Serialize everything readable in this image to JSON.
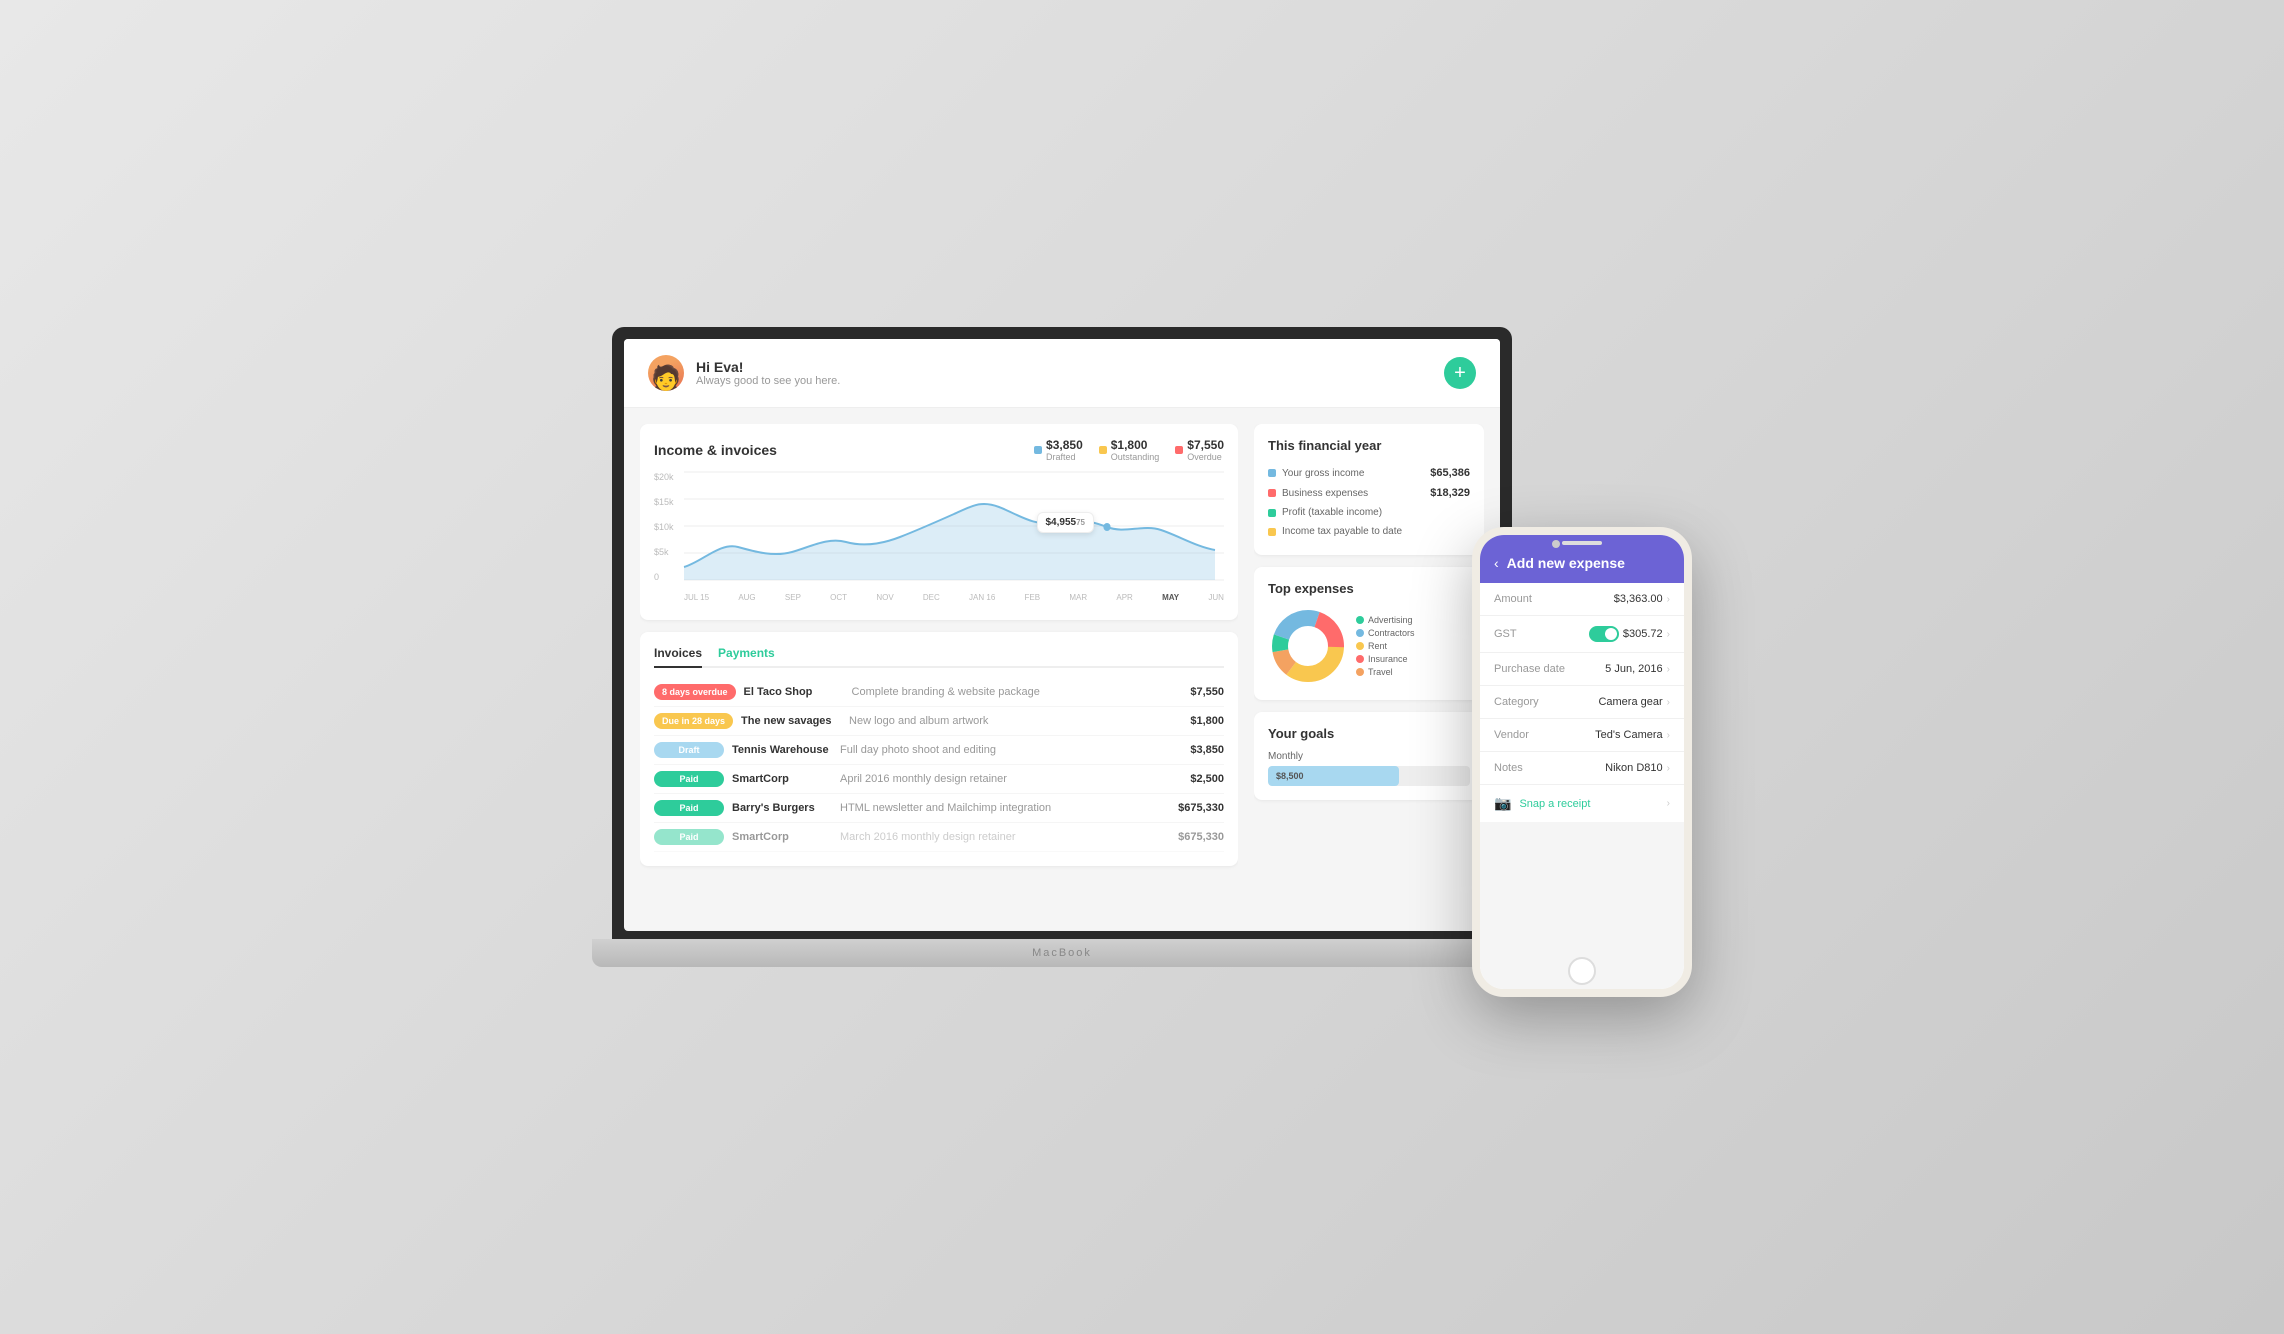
{
  "header": {
    "greeting_name": "Hi Eva!",
    "greeting_sub": "Always good to see you here.",
    "add_btn_label": "+"
  },
  "chart": {
    "title": "Income & invoices",
    "tooltip_value": "$4,955",
    "tooltip_suffix": "75",
    "legend": [
      {
        "color": "#74b9e0",
        "amount": "$3,850",
        "label": "Drafted"
      },
      {
        "color": "#f9c74f",
        "amount": "$1,800",
        "label": "Outstanding"
      },
      {
        "color": "#ff6b6b",
        "amount": "$7,550",
        "label": "Overdue"
      }
    ],
    "y_labels": [
      "$20k",
      "$15k",
      "$10k",
      "$5k",
      "0"
    ],
    "x_labels": [
      "JUL 15",
      "AUG",
      "SEP",
      "OCT",
      "NOV",
      "DEC",
      "JAN 16",
      "FEB",
      "MAR",
      "APR",
      "MAY",
      "JUN"
    ]
  },
  "invoices": {
    "tab_invoices": "Invoices",
    "tab_payments": "Payments",
    "rows": [
      {
        "badge": "8 days overdue",
        "badge_class": "badge-overdue",
        "client": "El Taco Shop",
        "desc": "Complete branding & website package",
        "amount": "$7,550"
      },
      {
        "badge": "Due in 28 days",
        "badge_class": "badge-due",
        "client": "The new savages",
        "desc": "New logo and album artwork",
        "amount": "$1,800"
      },
      {
        "badge": "Draft",
        "badge_class": "badge-draft",
        "client": "Tennis Warehouse",
        "desc": "Full day photo shoot and editing",
        "amount": "$3,850"
      },
      {
        "badge": "Paid",
        "badge_class": "badge-paid",
        "client": "SmartCorp",
        "desc": "April 2016 monthly design retainer",
        "amount": "$2,500"
      },
      {
        "badge": "Paid",
        "badge_class": "badge-paid",
        "client": "Barry's Burgers",
        "desc": "HTML newsletter and Mailchimp integration",
        "amount": "$675,330"
      },
      {
        "badge": "Paid",
        "badge_class": "badge-paid",
        "client": "SmartCorp",
        "desc": "March 2016 monthly design retainer",
        "amount": "$675,330"
      }
    ]
  },
  "financial_year": {
    "title": "This financial year",
    "rows": [
      {
        "color": "#74b9e0",
        "label": "Your gross income",
        "amount": "$65,386"
      },
      {
        "color": "#ff6b6b",
        "label": "Business expenses",
        "amount": "$18,329"
      },
      {
        "color": "#2ecc9b",
        "label": "Profit (taxable income)",
        "amount": ""
      },
      {
        "color": "#f9c74f",
        "label": "Income tax payable to date",
        "amount": ""
      }
    ]
  },
  "top_expenses": {
    "title": "Top expenses",
    "legend": [
      {
        "color": "#2ecc9b",
        "label": "Advertising"
      },
      {
        "color": "#74b9e0",
        "label": "Contractors"
      },
      {
        "color": "#f9c74f",
        "label": "Rent"
      },
      {
        "color": "#ff6b6b",
        "label": "Insurance"
      },
      {
        "color": "#f4a261",
        "label": "Travel"
      }
    ],
    "donut": {
      "segments": [
        {
          "color": "#f9c74f",
          "pct": 35
        },
        {
          "color": "#ff6b6b",
          "pct": 20
        },
        {
          "color": "#f4a261",
          "pct": 12
        },
        {
          "color": "#2ecc9b",
          "pct": 8
        },
        {
          "color": "#74b9e0",
          "pct": 25
        }
      ]
    }
  },
  "goals": {
    "title": "Your goals",
    "period": "Monthly",
    "bar_value": "$8,500",
    "bar_pct": 65
  },
  "phone": {
    "header_back": "‹",
    "header_title": "Add new expense",
    "rows": [
      {
        "label": "Amount",
        "value": "$3,363.00",
        "type": "value"
      },
      {
        "label": "GST",
        "value": "$305.72",
        "type": "toggle"
      },
      {
        "label": "Purchase date",
        "value": "5 Jun, 2016",
        "type": "value"
      },
      {
        "label": "Category",
        "value": "Camera gear",
        "type": "value"
      },
      {
        "label": "Vendor",
        "value": "Ted's Camera",
        "type": "value"
      },
      {
        "label": "Notes",
        "value": "Nikon D810",
        "type": "value"
      }
    ],
    "snap_receipt": "Snap a receipt"
  }
}
